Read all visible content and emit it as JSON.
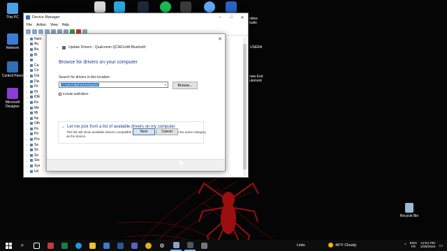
{
  "desktop": {
    "icons_left": [
      {
        "label": "This PC",
        "color": "#4aa0e6"
      },
      {
        "label": "Network",
        "color": "#3b7bd4"
      },
      {
        "label": "Control Panel",
        "color": "#2f6fb3"
      },
      {
        "label": "Microsoft Designer",
        "color": "#8b3bd6"
      }
    ],
    "icons_right": [
      {
        "label": "oblox",
        "sub": "tudio"
      },
      {
        "label": "USERA",
        "sub": ""
      },
      {
        "label": "new End",
        "sub": "ulement"
      }
    ],
    "recycle_bin": "Recycle Bin"
  },
  "device_manager": {
    "title": "Device Manager",
    "menu": [
      "File",
      "Action",
      "View",
      "Help"
    ],
    "tree_items": [
      "Nam",
      "Au",
      "Ba",
      "Bl",
      "",
      "Ca",
      "Co",
      "Dis",
      "Dis",
      "Fir",
      "HI",
      "IDE",
      "Ke",
      "Me",
      "Mi",
      "Ne",
      "Oth",
      "Po",
      "Pri",
      "Pro",
      "Se",
      "So",
      "So",
      "Sto",
      "Sys",
      "Un"
    ]
  },
  "dialog": {
    "header": "Update Drivers - Qualcomm QCA61x4A Bluetooth",
    "heading": "Browse for drivers on your computer",
    "search_label": "Search for drivers in this location:",
    "path_value": "C:\\Users\\Bahe\\Desktop\\52",
    "browse_label": "Browse...",
    "include_subfolders": "Include subfolders",
    "pick_link": "Let me pick from a list of available drivers on my computer",
    "pick_desc": "This list will show available drivers compatible with the device, and all drivers in the same category as the device.",
    "next_label": "Next",
    "cancel_label": "Cancel"
  },
  "taskbar": {
    "links": "Links",
    "weather": "46°F Cloudy",
    "lang_top": "ENG",
    "lang_bottom": "FR",
    "time": "12:51 PM",
    "date": "2/28/2024"
  }
}
